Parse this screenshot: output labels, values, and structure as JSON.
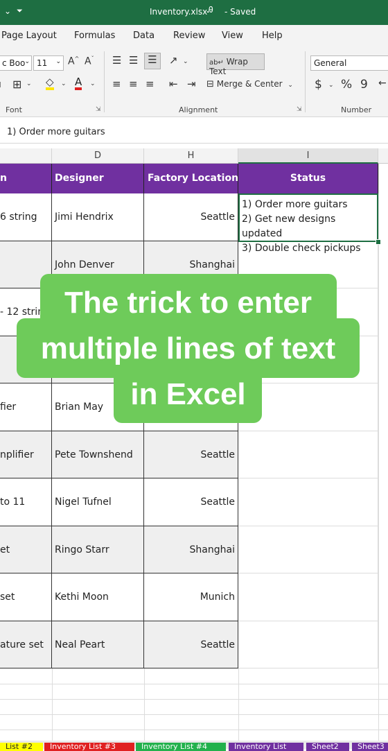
{
  "titlebar": {
    "filename": "Inventory.xlsx",
    "status": "- Saved"
  },
  "menu": [
    "Page Layout",
    "Formulas",
    "Data",
    "Review",
    "View",
    "Help"
  ],
  "ribbon": {
    "font_name": "c Boo",
    "font_size": "11",
    "wrap_text": "Wrap Text",
    "merge_center": "Merge & Center",
    "number_format": "General",
    "groups": {
      "font": "Font",
      "alignment": "Alignment",
      "number": "Number"
    }
  },
  "formula_bar": {
    "content": "1) Order more guitars"
  },
  "columns": {
    "d": "D",
    "h": "H",
    "i": "I"
  },
  "headers": {
    "c": "n",
    "d": "Designer",
    "h": "Factory Location",
    "i": "Status"
  },
  "status_lines": [
    "1) Order more guitars",
    "2) Get new designs updated",
    "3) Double check pickups"
  ],
  "rows": [
    {
      "c": "6 string",
      "d": "Jimi Hendrix",
      "h": "Seattle"
    },
    {
      "c": "",
      "d": "John Denver",
      "h": "Shanghai"
    },
    {
      "c": "- 12 strin",
      "d": "",
      "h": ""
    },
    {
      "c": "",
      "d": "",
      "h": ""
    },
    {
      "c": "fier",
      "d": "Brian May",
      "h": ""
    },
    {
      "c": "nplifier",
      "d": "Pete Townshend",
      "h": "Seattle"
    },
    {
      "c": "to 11",
      "d": "Nigel Tufnel",
      "h": "Seattle"
    },
    {
      "c": "et",
      "d": "Ringo Starr",
      "h": "Shanghai"
    },
    {
      "c": "set",
      "d": "Kethi Moon",
      "h": "Munich"
    },
    {
      "c": "ature set",
      "d": "Neal Peart",
      "h": "Seattle"
    }
  ],
  "overlay": {
    "line1": "The trick to enter",
    "line2": "multiple lines of text",
    "line3": "in Excel"
  },
  "sheet_tabs": [
    {
      "label": "List #2",
      "color": "#ffff00"
    },
    {
      "label": "Inventory List #3",
      "color": "#e02020"
    },
    {
      "label": "Inventory List #4",
      "color": "#22b14c"
    },
    {
      "label": "Inventory List",
      "color": "#7030a0"
    },
    {
      "label": "Sheet2",
      "color": "#7030a0"
    },
    {
      "label": "Sheet3",
      "color": "#7030a0"
    }
  ]
}
